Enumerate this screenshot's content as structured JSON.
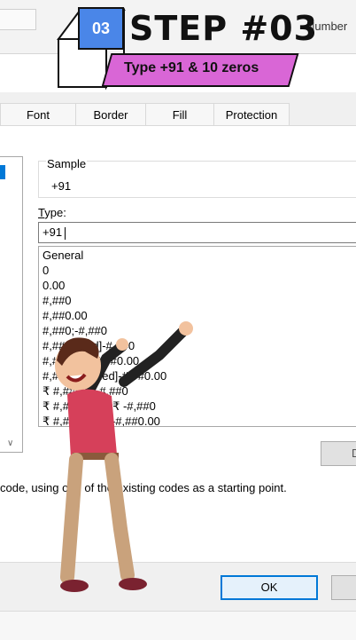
{
  "step_badge": {
    "number": "03",
    "title": "STEP #03",
    "subtitle": "Type +91 & 10 zeros",
    "colors": {
      "number_box": "#4a86e8",
      "banner": "#d966d6"
    }
  },
  "ribbon": {
    "number_label": "Number"
  },
  "tabs": [
    {
      "label": "Font"
    },
    {
      "label": "Border"
    },
    {
      "label": "Fill"
    },
    {
      "label": "Protection"
    }
  ],
  "sample": {
    "label": "Sample",
    "value": "+91"
  },
  "type_field": {
    "label": "Type:",
    "value": "+91"
  },
  "format_list": [
    "General",
    "0",
    "0.00",
    "#,##0",
    "#,##0.00",
    "#,##0;-#,##0",
    "#,##0;[Red]-#,##0",
    "#,##0.00;-#,##0.00",
    "#,##0.00;[Red]-#,##0.00",
    "₹ #,##0;₹ -#,##0",
    "₹ #,##0;[Red]₹ -#,##0",
    "₹ #,##0.00;₹ -#,##0.00"
  ],
  "delete_button": {
    "label": "D"
  },
  "hint": "code, using one of the existing codes as a starting point.",
  "ok_button": {
    "label": "OK"
  },
  "accent_color": "#0078d7"
}
